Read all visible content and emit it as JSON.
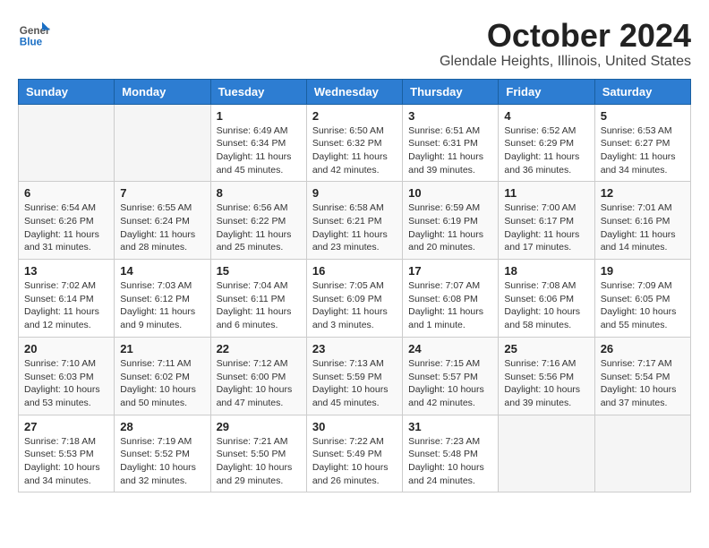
{
  "header": {
    "logo_general": "General",
    "logo_blue": "Blue",
    "month_title": "October 2024",
    "location": "Glendale Heights, Illinois, United States"
  },
  "days_of_week": [
    "Sunday",
    "Monday",
    "Tuesday",
    "Wednesday",
    "Thursday",
    "Friday",
    "Saturday"
  ],
  "weeks": [
    [
      {
        "day": "",
        "sunrise": "",
        "sunset": "",
        "daylight": ""
      },
      {
        "day": "",
        "sunrise": "",
        "sunset": "",
        "daylight": ""
      },
      {
        "day": "1",
        "sunrise": "Sunrise: 6:49 AM",
        "sunset": "Sunset: 6:34 PM",
        "daylight": "Daylight: 11 hours and 45 minutes."
      },
      {
        "day": "2",
        "sunrise": "Sunrise: 6:50 AM",
        "sunset": "Sunset: 6:32 PM",
        "daylight": "Daylight: 11 hours and 42 minutes."
      },
      {
        "day": "3",
        "sunrise": "Sunrise: 6:51 AM",
        "sunset": "Sunset: 6:31 PM",
        "daylight": "Daylight: 11 hours and 39 minutes."
      },
      {
        "day": "4",
        "sunrise": "Sunrise: 6:52 AM",
        "sunset": "Sunset: 6:29 PM",
        "daylight": "Daylight: 11 hours and 36 minutes."
      },
      {
        "day": "5",
        "sunrise": "Sunrise: 6:53 AM",
        "sunset": "Sunset: 6:27 PM",
        "daylight": "Daylight: 11 hours and 34 minutes."
      }
    ],
    [
      {
        "day": "6",
        "sunrise": "Sunrise: 6:54 AM",
        "sunset": "Sunset: 6:26 PM",
        "daylight": "Daylight: 11 hours and 31 minutes."
      },
      {
        "day": "7",
        "sunrise": "Sunrise: 6:55 AM",
        "sunset": "Sunset: 6:24 PM",
        "daylight": "Daylight: 11 hours and 28 minutes."
      },
      {
        "day": "8",
        "sunrise": "Sunrise: 6:56 AM",
        "sunset": "Sunset: 6:22 PM",
        "daylight": "Daylight: 11 hours and 25 minutes."
      },
      {
        "day": "9",
        "sunrise": "Sunrise: 6:58 AM",
        "sunset": "Sunset: 6:21 PM",
        "daylight": "Daylight: 11 hours and 23 minutes."
      },
      {
        "day": "10",
        "sunrise": "Sunrise: 6:59 AM",
        "sunset": "Sunset: 6:19 PM",
        "daylight": "Daylight: 11 hours and 20 minutes."
      },
      {
        "day": "11",
        "sunrise": "Sunrise: 7:00 AM",
        "sunset": "Sunset: 6:17 PM",
        "daylight": "Daylight: 11 hours and 17 minutes."
      },
      {
        "day": "12",
        "sunrise": "Sunrise: 7:01 AM",
        "sunset": "Sunset: 6:16 PM",
        "daylight": "Daylight: 11 hours and 14 minutes."
      }
    ],
    [
      {
        "day": "13",
        "sunrise": "Sunrise: 7:02 AM",
        "sunset": "Sunset: 6:14 PM",
        "daylight": "Daylight: 11 hours and 12 minutes."
      },
      {
        "day": "14",
        "sunrise": "Sunrise: 7:03 AM",
        "sunset": "Sunset: 6:12 PM",
        "daylight": "Daylight: 11 hours and 9 minutes."
      },
      {
        "day": "15",
        "sunrise": "Sunrise: 7:04 AM",
        "sunset": "Sunset: 6:11 PM",
        "daylight": "Daylight: 11 hours and 6 minutes."
      },
      {
        "day": "16",
        "sunrise": "Sunrise: 7:05 AM",
        "sunset": "Sunset: 6:09 PM",
        "daylight": "Daylight: 11 hours and 3 minutes."
      },
      {
        "day": "17",
        "sunrise": "Sunrise: 7:07 AM",
        "sunset": "Sunset: 6:08 PM",
        "daylight": "Daylight: 11 hours and 1 minute."
      },
      {
        "day": "18",
        "sunrise": "Sunrise: 7:08 AM",
        "sunset": "Sunset: 6:06 PM",
        "daylight": "Daylight: 10 hours and 58 minutes."
      },
      {
        "day": "19",
        "sunrise": "Sunrise: 7:09 AM",
        "sunset": "Sunset: 6:05 PM",
        "daylight": "Daylight: 10 hours and 55 minutes."
      }
    ],
    [
      {
        "day": "20",
        "sunrise": "Sunrise: 7:10 AM",
        "sunset": "Sunset: 6:03 PM",
        "daylight": "Daylight: 10 hours and 53 minutes."
      },
      {
        "day": "21",
        "sunrise": "Sunrise: 7:11 AM",
        "sunset": "Sunset: 6:02 PM",
        "daylight": "Daylight: 10 hours and 50 minutes."
      },
      {
        "day": "22",
        "sunrise": "Sunrise: 7:12 AM",
        "sunset": "Sunset: 6:00 PM",
        "daylight": "Daylight: 10 hours and 47 minutes."
      },
      {
        "day": "23",
        "sunrise": "Sunrise: 7:13 AM",
        "sunset": "Sunset: 5:59 PM",
        "daylight": "Daylight: 10 hours and 45 minutes."
      },
      {
        "day": "24",
        "sunrise": "Sunrise: 7:15 AM",
        "sunset": "Sunset: 5:57 PM",
        "daylight": "Daylight: 10 hours and 42 minutes."
      },
      {
        "day": "25",
        "sunrise": "Sunrise: 7:16 AM",
        "sunset": "Sunset: 5:56 PM",
        "daylight": "Daylight: 10 hours and 39 minutes."
      },
      {
        "day": "26",
        "sunrise": "Sunrise: 7:17 AM",
        "sunset": "Sunset: 5:54 PM",
        "daylight": "Daylight: 10 hours and 37 minutes."
      }
    ],
    [
      {
        "day": "27",
        "sunrise": "Sunrise: 7:18 AM",
        "sunset": "Sunset: 5:53 PM",
        "daylight": "Daylight: 10 hours and 34 minutes."
      },
      {
        "day": "28",
        "sunrise": "Sunrise: 7:19 AM",
        "sunset": "Sunset: 5:52 PM",
        "daylight": "Daylight: 10 hours and 32 minutes."
      },
      {
        "day": "29",
        "sunrise": "Sunrise: 7:21 AM",
        "sunset": "Sunset: 5:50 PM",
        "daylight": "Daylight: 10 hours and 29 minutes."
      },
      {
        "day": "30",
        "sunrise": "Sunrise: 7:22 AM",
        "sunset": "Sunset: 5:49 PM",
        "daylight": "Daylight: 10 hours and 26 minutes."
      },
      {
        "day": "31",
        "sunrise": "Sunrise: 7:23 AM",
        "sunset": "Sunset: 5:48 PM",
        "daylight": "Daylight: 10 hours and 24 minutes."
      },
      {
        "day": "",
        "sunrise": "",
        "sunset": "",
        "daylight": ""
      },
      {
        "day": "",
        "sunrise": "",
        "sunset": "",
        "daylight": ""
      }
    ]
  ]
}
